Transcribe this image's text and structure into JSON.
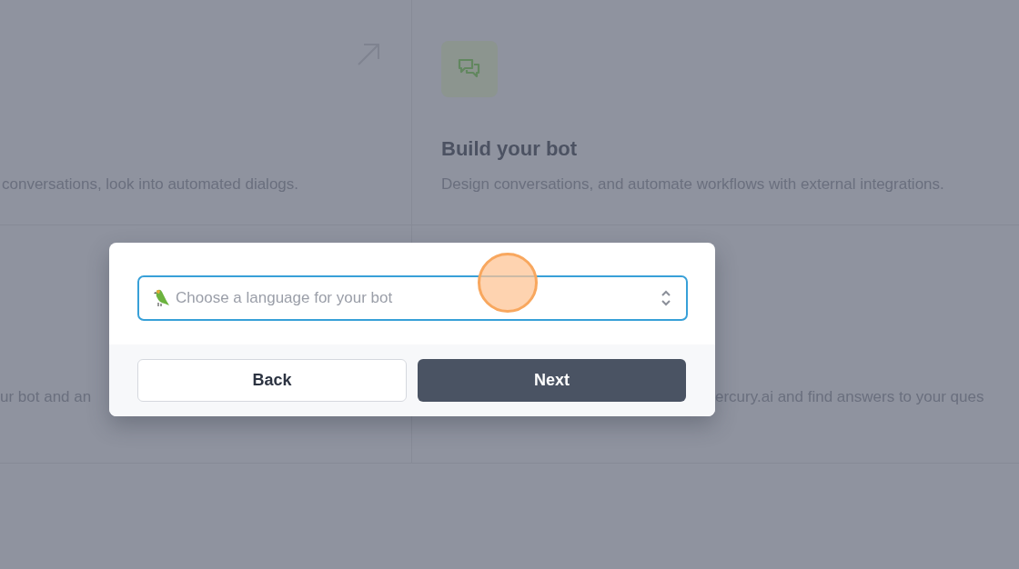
{
  "cards": [
    {
      "description": "conversations, look into automated dialogs."
    },
    {
      "title": "Build your bot",
      "description": "Design conversations, and automate workflows with external integrations."
    },
    {
      "description": "ur bot and an"
    },
    {
      "description": "ercury.ai and find answers to your ques"
    }
  ],
  "dialog": {
    "select": {
      "placeholder": "Choose a language for your bot"
    },
    "buttons": [
      {
        "label": "Back",
        "kind": "secondary"
      },
      {
        "label": "Next",
        "kind": "primary"
      }
    ]
  }
}
